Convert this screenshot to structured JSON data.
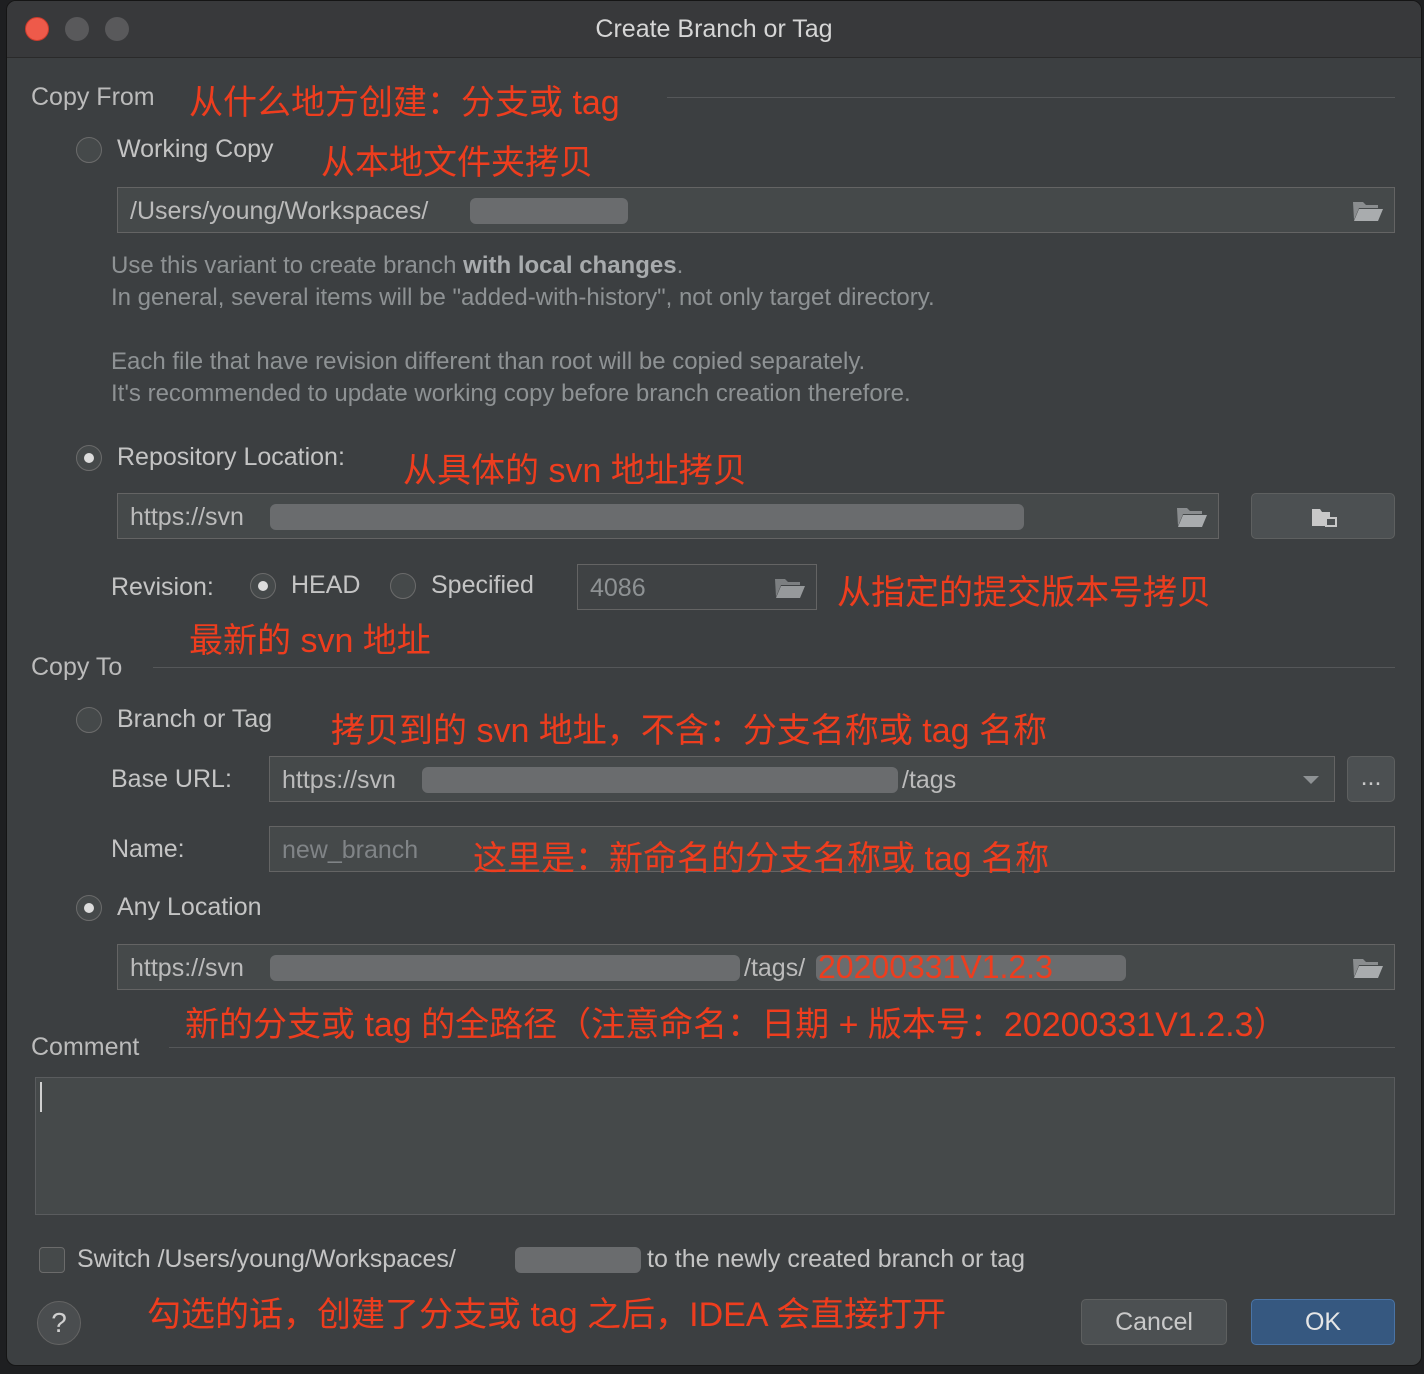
{
  "window": {
    "title": "Create Branch or Tag"
  },
  "copy_from": {
    "section_title": "Copy From",
    "annotation": "从什么地方创建：分支或 tag",
    "working_copy": {
      "label": "Working Copy",
      "annotation": "从本地文件夹拷贝",
      "path": "/Users/young/Workspaces/",
      "hint_line1_pre": "Use this variant to create branch ",
      "hint_line1_bold": "with local changes",
      "hint_line1_post": ".",
      "hint_line2": "In general, several items will be \"added-with-history\", not only target directory.",
      "hint_line3": "Each file that have revision different than root will be copied separately.",
      "hint_line4": "It's recommended to update working copy before branch creation therefore."
    },
    "repository_location": {
      "label": "Repository Location:",
      "annotation": "从具体的 svn 地址拷贝",
      "url": "https://svn"
    },
    "revision": {
      "label": "Revision:",
      "head_label": "HEAD",
      "specified_label": "Specified",
      "value": "4086",
      "annotation_specified": "从指定的提交版本号拷贝",
      "annotation_head": "最新的 svn 地址"
    }
  },
  "copy_to": {
    "section_title": "Copy To",
    "branch_or_tag": {
      "label": "Branch or Tag",
      "annotation": "拷贝到的 svn 地址，不含：分支名称或 tag 名称",
      "base_url_label": "Base URL:",
      "base_url_prefix": "https://svn",
      "base_url_suffix": "/tags",
      "browse_label": "...",
      "name_label": "Name:",
      "name_placeholder": "new_branch",
      "name_annotation": "这里是：新命名的分支名称或 tag 名称"
    },
    "any_location": {
      "label": "Any Location",
      "url_prefix": "https://svn",
      "url_middle": "/tags/",
      "url_highlight": "20200331V1.2.3",
      "annotation": "新的分支或 tag 的全路径（注意命名：日期 + 版本号：20200331V1.2.3）"
    }
  },
  "comment": {
    "section_title": "Comment",
    "value": ""
  },
  "switch": {
    "label_pre": "Switch /Users/young/Workspaces/",
    "label_post": "to the newly created branch or tag",
    "checked": false,
    "annotation": "勾选的话，创建了分支或 tag 之后，IDEA 会直接打开"
  },
  "buttons": {
    "help": "?",
    "cancel": "Cancel",
    "ok": "OK"
  },
  "colors": {
    "annotation": "#ee3d1e",
    "ok_button": "#365880",
    "background": "#3c3f41"
  }
}
